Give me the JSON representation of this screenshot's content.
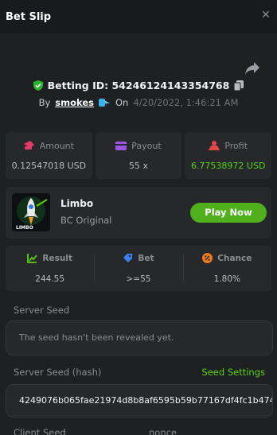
{
  "header": {
    "title": "Bet Slip"
  },
  "bet": {
    "id_label": "Betting ID: 54246124143354768",
    "by_label": "By",
    "user": "smokes",
    "on_label": "On",
    "date": "4/20/2022, 1:46:21 AM"
  },
  "stats": [
    {
      "icon": "amount-icon",
      "label": "Amount",
      "value": "0.12547018 USD",
      "color": "#e23c64"
    },
    {
      "icon": "payout-icon",
      "label": "Payout",
      "value": "55 x",
      "color": "#a054e6"
    },
    {
      "icon": "profit-icon",
      "label": "Profit",
      "value": "6.77538972 USD",
      "color": "#e24848"
    }
  ],
  "game": {
    "name": "Limbo",
    "provider": "BC Original",
    "play_label": "Play Now",
    "thumb_text": "LIMBO"
  },
  "details": [
    {
      "icon": "result-icon",
      "label": "Result",
      "value": "244.55",
      "color": "#5ad30f"
    },
    {
      "icon": "bet-icon",
      "label": "Bet",
      "value": ">=55",
      "color": "#3b82f6"
    },
    {
      "icon": "chance-icon",
      "label": "Chance",
      "value": "1.80%",
      "color": "#f07a1a"
    }
  ],
  "seeds": {
    "server_seed_label": "Server Seed",
    "server_seed_value": "The seed hasn't been revealed yet.",
    "server_hash_label": "Server Seed (hash)",
    "seed_settings_label": "Seed Settings",
    "server_hash_value": "4249076b065fae21974d8b8af6595b59b77167df4fc1b474a",
    "client_seed_label": "Client Seed",
    "nonce_label": "nonce"
  }
}
